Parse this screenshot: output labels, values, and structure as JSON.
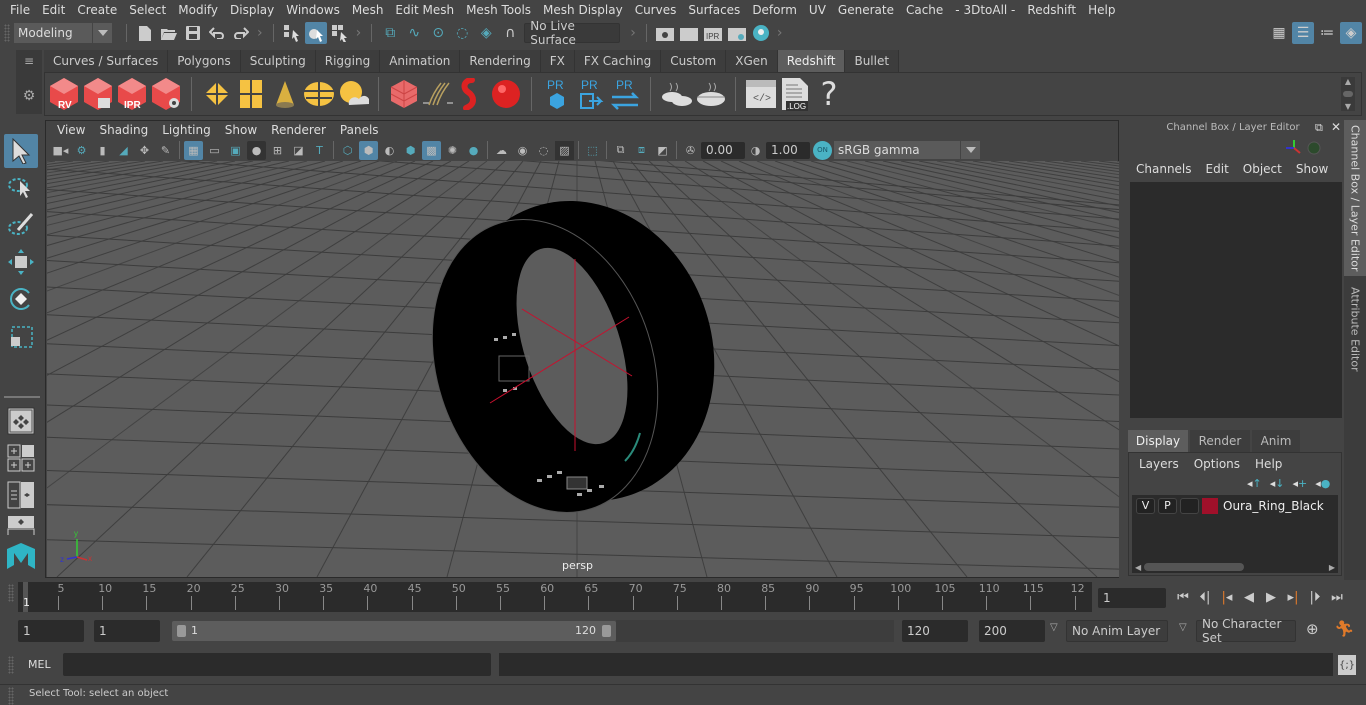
{
  "menubar": {
    "items": [
      "File",
      "Edit",
      "Create",
      "Select",
      "Modify",
      "Display",
      "Windows",
      "Mesh",
      "Edit Mesh",
      "Mesh Tools",
      "Mesh Display",
      "Curves",
      "Surfaces",
      "Deform",
      "UV",
      "Generate",
      "Cache",
      "- 3DtoAll -",
      "Redshift",
      "Help"
    ]
  },
  "statusline": {
    "mode": "Modeling",
    "live_surface": "No Live Surface"
  },
  "shelf": {
    "tabs": [
      "Curves / Surfaces",
      "Polygons",
      "Sculpting",
      "Rigging",
      "Animation",
      "Rendering",
      "FX",
      "FX Caching",
      "Custom",
      "XGen",
      "Redshift",
      "Bullet"
    ],
    "active_tab": "Redshift",
    "icons": {
      "rv": "RV",
      "ipr": "IPR",
      "pr": "PR",
      "log": ".LOG",
      "help": "?"
    }
  },
  "viewport": {
    "menu": [
      "View",
      "Shading",
      "Lighting",
      "Show",
      "Renderer",
      "Panels"
    ],
    "exposure": "0.00",
    "gamma": "1.00",
    "color_management_toggle": "ON",
    "color_space": "sRGB gamma",
    "camera_label": "persp",
    "axis": {
      "x": "x",
      "y": "y",
      "z": "z"
    },
    "colors": {
      "background": "#5c5c5c",
      "object": "#000000",
      "pivot": "#c8102e"
    }
  },
  "channel_box": {
    "title": "Channel Box / Layer Editor",
    "menu": [
      "Channels",
      "Edit",
      "Object",
      "Show"
    ],
    "layer_tabs": [
      "Display",
      "Render",
      "Anim"
    ],
    "active_layer_tab": "Display",
    "layer_menu": [
      "Layers",
      "Options",
      "Help"
    ],
    "layers": [
      {
        "visible": "V",
        "playback": "P",
        "name": "Oura_Ring_Black",
        "color": "#a0102a"
      }
    ]
  },
  "side_tabs": [
    "Channel Box / Layer Editor",
    "Attribute Editor"
  ],
  "timeline": {
    "ticks": [
      "5",
      "10",
      "15",
      "20",
      "25",
      "30",
      "35",
      "40",
      "45",
      "50",
      "55",
      "60",
      "65",
      "70",
      "75",
      "80",
      "85",
      "90",
      "95",
      "100",
      "105",
      "110",
      "115",
      "12"
    ],
    "current_frame_marker": "1",
    "current_frame": "1",
    "accent": "#e07a2a"
  },
  "range": {
    "start": "1",
    "playback_start": "1",
    "slider_min_label": "1",
    "slider_max_label": "120",
    "playback_end": "120",
    "end": "200",
    "anim_layer": "No Anim Layer",
    "character_set": "No Character Set"
  },
  "command_line": {
    "label": "MEL",
    "value": ""
  },
  "help_line": "Select Tool: select an object"
}
